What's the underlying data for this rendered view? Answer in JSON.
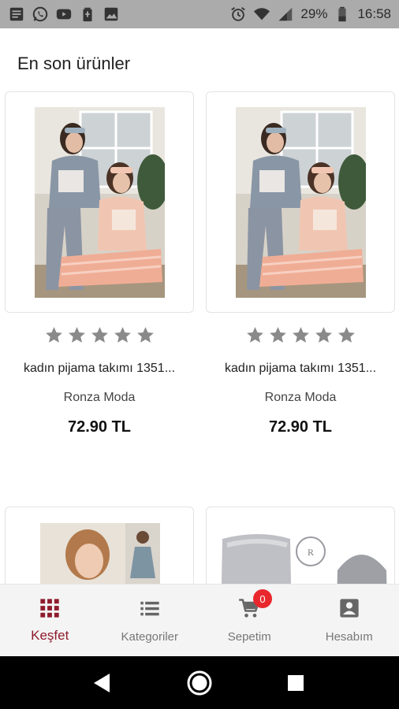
{
  "status_bar": {
    "battery": "29%",
    "time": "16:58",
    "left_icons": [
      "notes-icon",
      "whatsapp-icon",
      "youtube-icon",
      "battery-saver-icon",
      "gallery-icon"
    ],
    "right_icons": [
      "alarm-icon",
      "wifi-icon",
      "signal-icon",
      "battery-icon"
    ]
  },
  "section": {
    "title": "En son ürünler"
  },
  "products": [
    {
      "name": "kadın pijama takımı 1351...",
      "seller": "Ronza Moda",
      "price": "72.90 TL",
      "rating": 0
    },
    {
      "name": "kadın pijama takımı  1351...",
      "seller": "Ronza Moda",
      "price": "72.90 TL",
      "rating": 0
    },
    {
      "name": "",
      "seller": "",
      "price": ""
    },
    {
      "name": "",
      "seller": "",
      "price": ""
    }
  ],
  "bottom_nav": {
    "items": [
      {
        "label": "Keşfet",
        "icon": "grid-icon",
        "active": true
      },
      {
        "label": "Kategoriler",
        "icon": "list-icon",
        "active": false
      },
      {
        "label": "Sepetim",
        "icon": "cart-icon",
        "active": false,
        "badge": "0"
      },
      {
        "label": "Hesabım",
        "icon": "account-icon",
        "active": false
      }
    ],
    "active_color": "#8f1c2c",
    "badge_color": "#e8282d"
  },
  "system_nav": {
    "buttons": [
      "back-icon",
      "home-icon",
      "recents-icon"
    ]
  }
}
